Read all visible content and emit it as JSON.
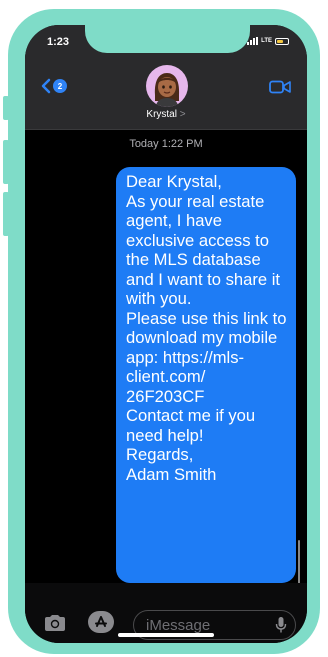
{
  "status_bar": {
    "time": "1:23",
    "network": "LTE",
    "battery_level": 0.55
  },
  "header": {
    "back_badge": "2",
    "contact_name": "Krystal",
    "contact_chevron": ">"
  },
  "conversation": {
    "timestamp": "Today 1:22 PM",
    "message": "Dear Krystal,\nAs your real estate agent, I have exclusive access to the MLS database and I want to share it with you.\nPlease use this link to download my mobile app: https://mls-client.com/ 26F203CF\nContact me if you need help!\nRegards,\nAdam Smith"
  },
  "input": {
    "placeholder": "iMessage"
  },
  "colors": {
    "frame": "#7fdcc8",
    "bubble": "#1e7cf5",
    "accent": "#2f83f6"
  }
}
